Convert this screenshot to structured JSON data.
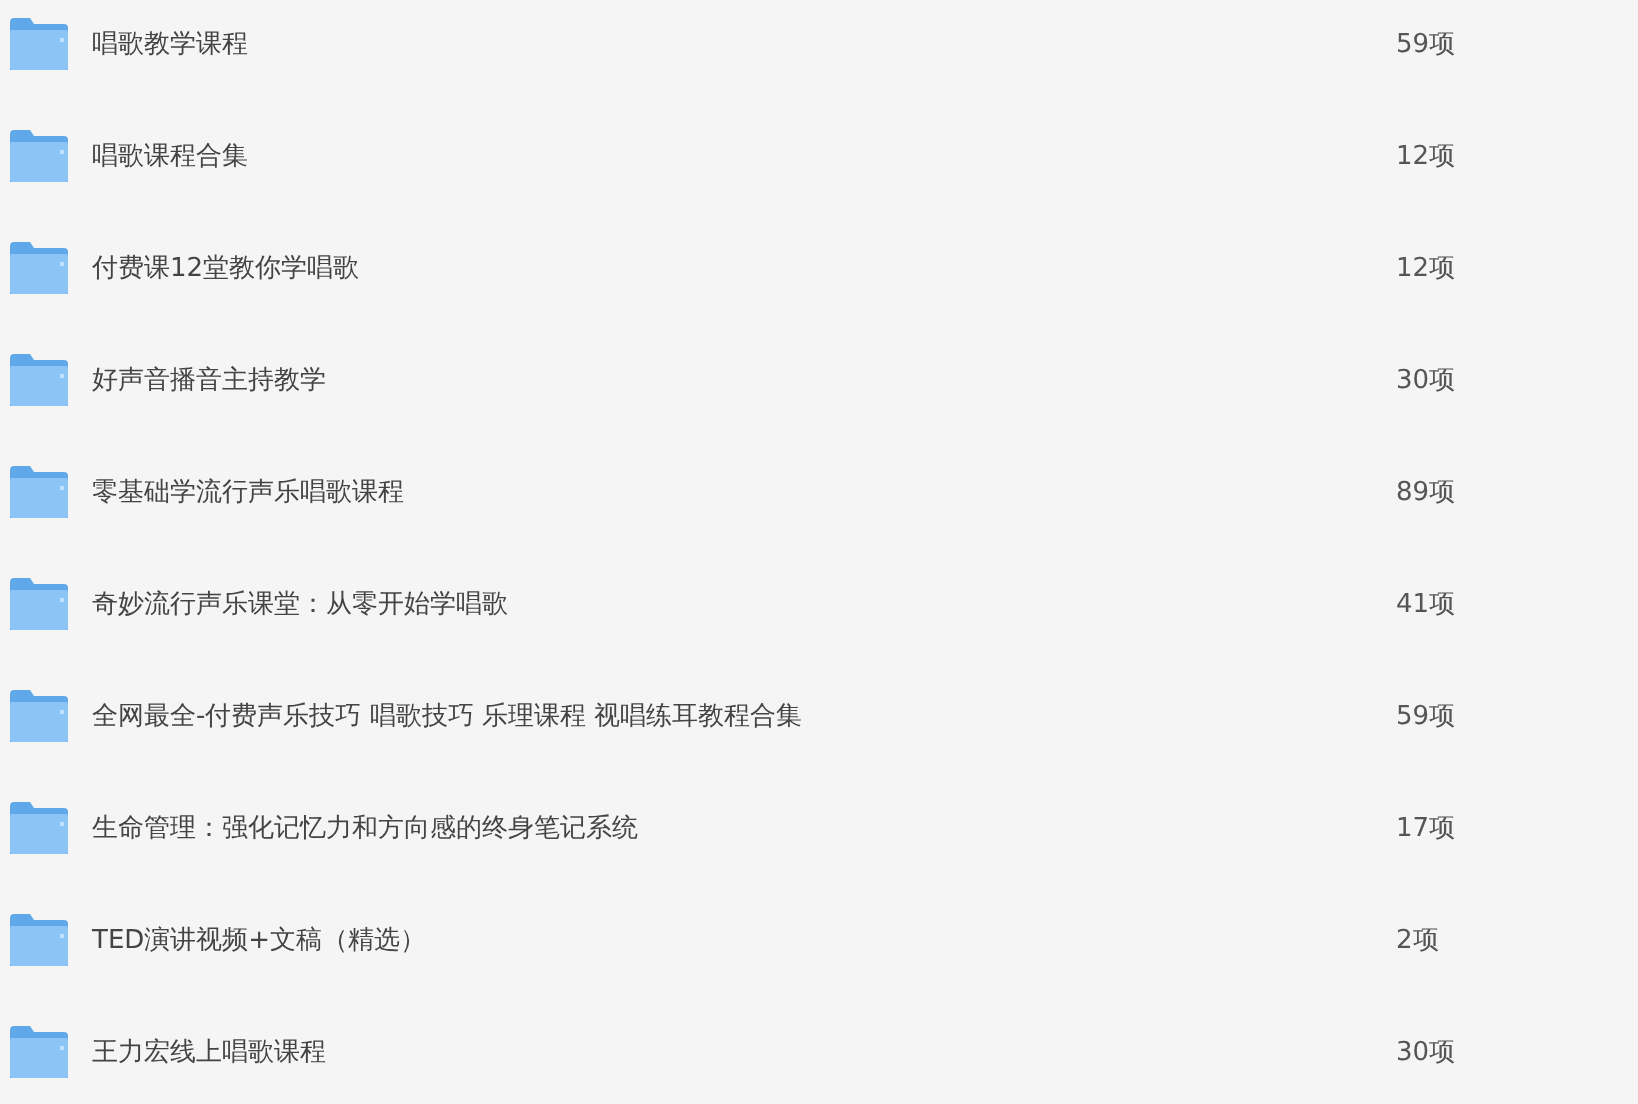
{
  "folders": [
    {
      "name": "唱歌教学课程",
      "count": "59项"
    },
    {
      "name": "唱歌课程合集",
      "count": "12项"
    },
    {
      "name": "付费课12堂教你学唱歌",
      "count": "12项"
    },
    {
      "name": "好声音播音主持教学",
      "count": "30项"
    },
    {
      "name": "零基础学流行声乐唱歌课程",
      "count": "89项"
    },
    {
      "name": "奇妙流行声乐课堂：从零开始学唱歌",
      "count": "41项"
    },
    {
      "name": "全网最全-付费声乐技巧 唱歌技巧 乐理课程 视唱练耳教程合集",
      "count": "59项"
    },
    {
      "name": "生命管理：强化记忆力和方向感的终身笔记系统",
      "count": "17项"
    },
    {
      "name": "TED演讲视频+文稿（精选）",
      "count": "2项"
    },
    {
      "name": "王力宏线上唱歌课程",
      "count": "30项"
    }
  ]
}
